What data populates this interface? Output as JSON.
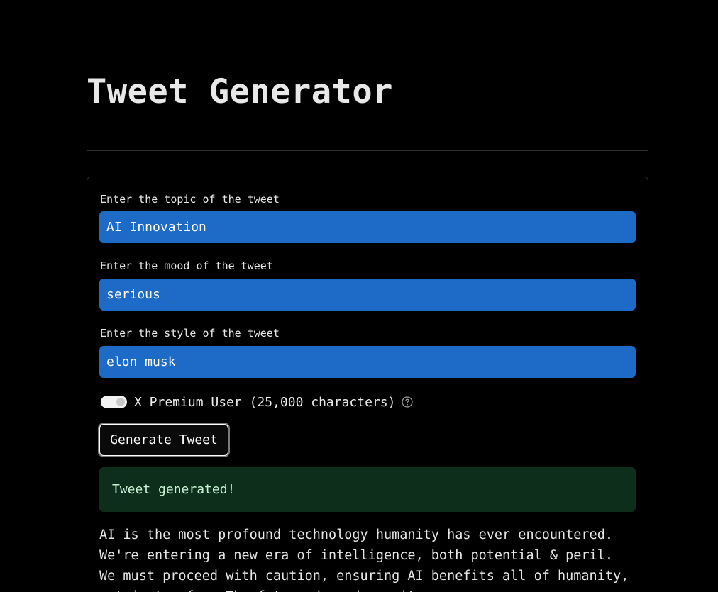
{
  "page": {
    "title": "Tweet Generator"
  },
  "form": {
    "topic": {
      "label": "Enter the topic of the tweet",
      "value": "AI Innovation"
    },
    "mood": {
      "label": "Enter the mood of the tweet",
      "value": "serious"
    },
    "style": {
      "label": "Enter the style of the tweet",
      "value": "elon musk"
    },
    "premium_toggle": {
      "label": "X Premium User (25,000 characters)",
      "checked": true,
      "help_icon": "question-circle-icon"
    },
    "generate_label": "Generate Tweet"
  },
  "result": {
    "status": "Tweet generated!",
    "tweet": "AI is the most profound technology humanity has ever encountered. We're entering a new era of intelligence, both potential & peril. We must proceed with caution, ensuring AI benefits all of humanity, not just a few. The future depends on it."
  },
  "colors": {
    "background": "#000000",
    "input_bg": "#1e6bc7",
    "success_bg": "#0e2e1c",
    "success_text": "#c9f2d4"
  }
}
